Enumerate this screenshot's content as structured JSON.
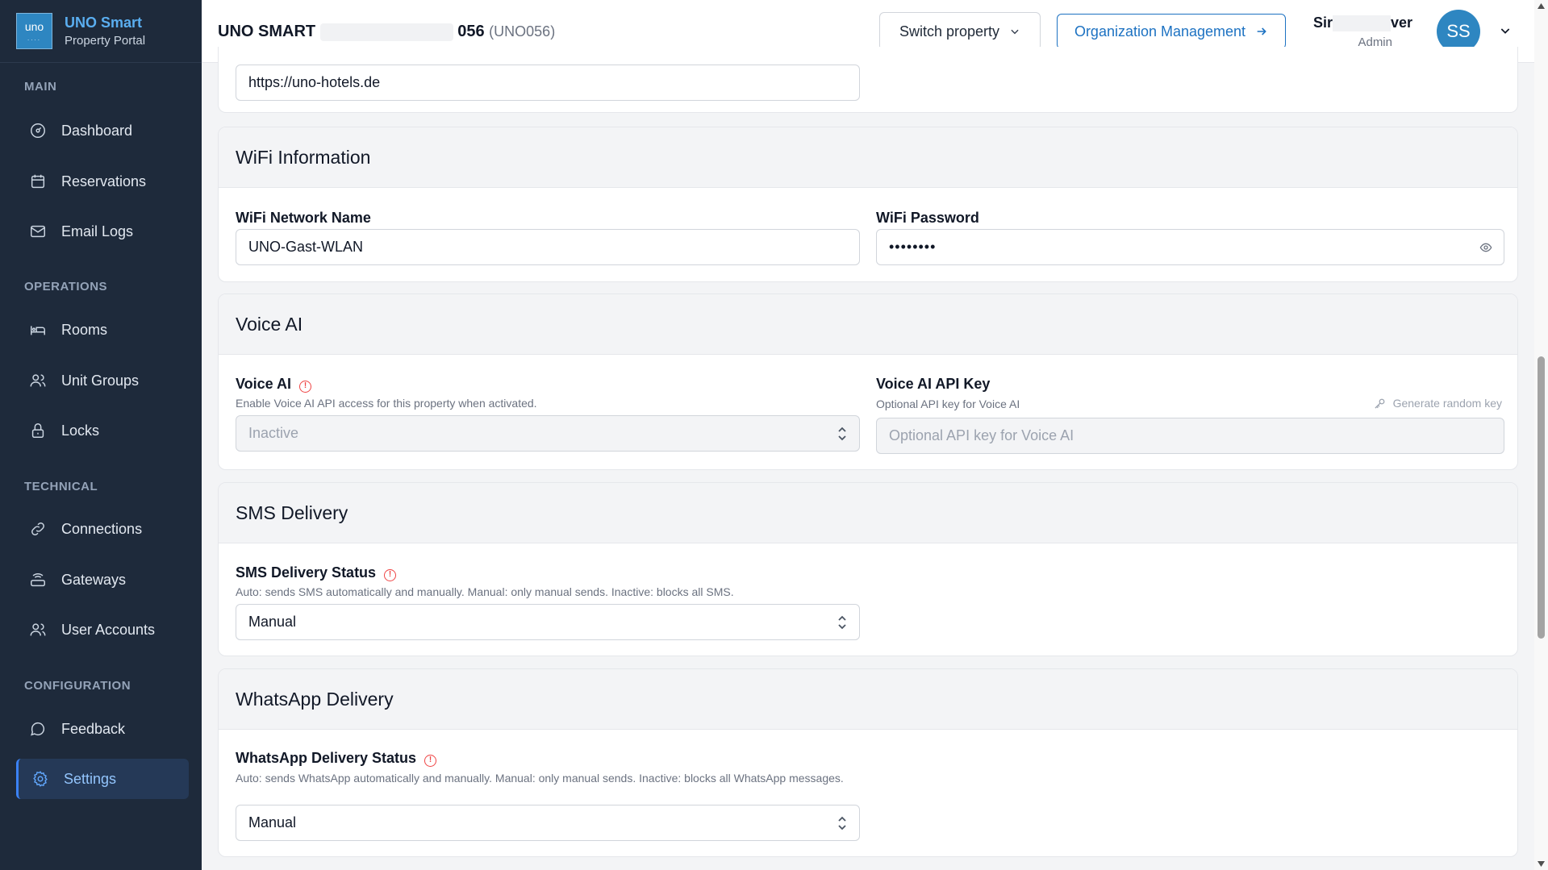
{
  "brand": {
    "logo_text": "uno",
    "logo_dots": "....",
    "title": "UNO Smart",
    "subtitle": "Property Portal"
  },
  "sidebar": {
    "sections": [
      {
        "title": "MAIN",
        "items": [
          "Dashboard",
          "Reservations",
          "Email Logs"
        ]
      },
      {
        "title": "OPERATIONS",
        "items": [
          "Rooms",
          "Unit Groups",
          "Locks"
        ]
      },
      {
        "title": "TECHNICAL",
        "items": [
          "Connections",
          "Gateways",
          "User Accounts"
        ]
      },
      {
        "title": "CONFIGURATION",
        "items": [
          "Feedback",
          "Settings"
        ]
      }
    ],
    "active": "Settings"
  },
  "header": {
    "property_prefix": "UNO SMART",
    "property_suffix": "056",
    "property_code": "(UNO056)",
    "switch_label": "Switch property",
    "org_label": "Organization Management",
    "user_first": "Sir",
    "user_last": "ver",
    "user_role": "Admin",
    "avatar_initials": "SS"
  },
  "website": {
    "value": "https://uno-hotels.de"
  },
  "wifi": {
    "title": "WiFi Information",
    "network_label": "WiFi Network Name",
    "network_value": "UNO-Gast-WLAN",
    "password_label": "WiFi Password",
    "password_value": "••••••••"
  },
  "voice": {
    "title": "Voice AI",
    "label": "Voice AI",
    "help": "Enable Voice AI API access for this property when activated.",
    "value": "Inactive",
    "key_label": "Voice AI API Key",
    "key_help": "Optional API key for Voice AI",
    "generate_label": "Generate random key",
    "key_placeholder": "Optional API key for Voice AI"
  },
  "sms": {
    "title": "SMS Delivery",
    "label": "SMS Delivery Status",
    "help": "Auto: sends SMS automatically and manually. Manual: only manual sends. Inactive: blocks all SMS.",
    "value": "Manual"
  },
  "whatsapp": {
    "title": "WhatsApp Delivery",
    "label": "WhatsApp Delivery Status",
    "help": "Auto: sends WhatsApp automatically and manually. Manual: only manual sends. Inactive: blocks all WhatsApp messages.",
    "value": "Manual"
  },
  "colors": {
    "sidebar_bg": "#1e2a3b",
    "accent": "#2e86c1",
    "link": "#1d72c2",
    "danger": "#ef4444"
  }
}
